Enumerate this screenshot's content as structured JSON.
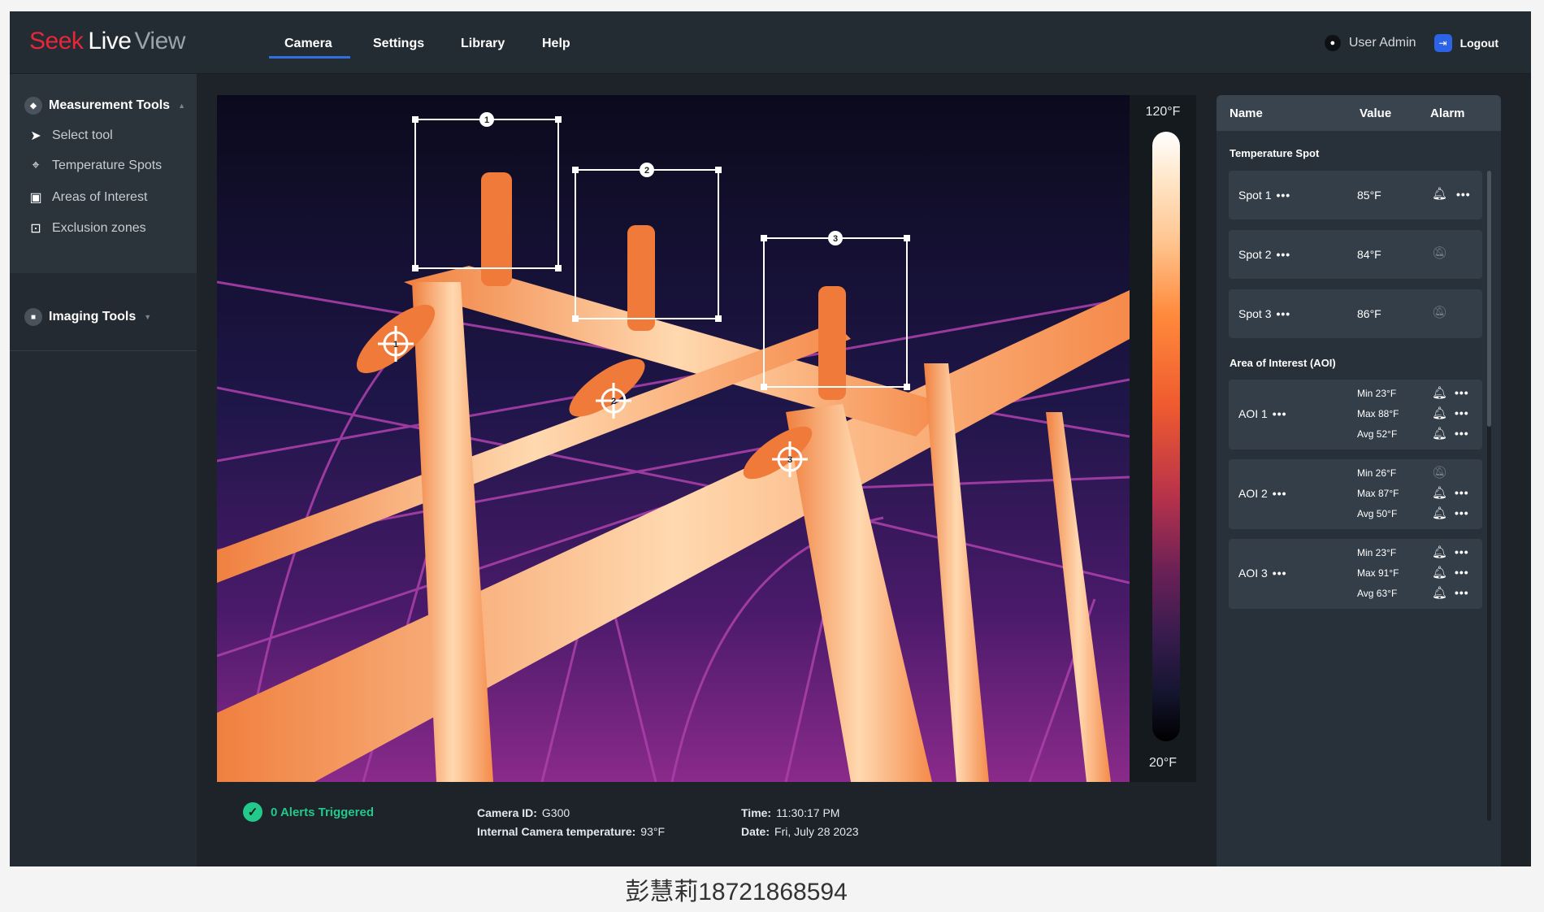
{
  "brand": {
    "part1": "Seek",
    "part2": "Live",
    "part3": "View"
  },
  "nav": {
    "tabs": [
      "Camera",
      "Settings",
      "Library",
      "Help"
    ],
    "active": "Camera"
  },
  "user": {
    "label": "User Admin",
    "logout": "Logout"
  },
  "sidebar": {
    "measurement_title": "Measurement Tools",
    "tools": [
      "Select tool",
      "Temperature Spots",
      "Areas of Interest",
      "Exclusion zones"
    ],
    "imaging_title": "Imaging Tools"
  },
  "camera": {
    "roi_labels": [
      "1",
      "2",
      "3"
    ],
    "spot_labels": [
      "1",
      "2",
      "3"
    ]
  },
  "scale": {
    "max": "120°F",
    "min": "20°F"
  },
  "status": {
    "alerts": "0 Alerts Triggered",
    "camera_id_label": "Camera ID:",
    "camera_id": "G300",
    "internal_temp_label": "Internal Camera temperature:",
    "internal_temp": "93°F",
    "time_label": "Time:",
    "time": "11:30:17 PM",
    "date_label": "Date:",
    "date": "Fri, July 28 2023"
  },
  "panel": {
    "headers": {
      "name": "Name",
      "value": "Value",
      "alarm": "Alarm"
    },
    "spot_group": "Temperature Spot",
    "spots": [
      {
        "name": "Spot 1",
        "value": "85°F",
        "alarm": "on"
      },
      {
        "name": "Spot 2",
        "value": "84°F",
        "alarm": "off"
      },
      {
        "name": "Spot 3",
        "value": "86°F",
        "alarm": "off"
      }
    ],
    "aoi_group": "Area of Interest (AOI)",
    "aois": [
      {
        "name": "AOI 1",
        "rows": [
          {
            "label": "Min 23°F",
            "alarm": "on"
          },
          {
            "label": "Max 88°F",
            "alarm": "on"
          },
          {
            "label": "Avg 52°F",
            "alarm": "on"
          }
        ]
      },
      {
        "name": "AOI 2",
        "rows": [
          {
            "label": "Min 26°F",
            "alarm": "off"
          },
          {
            "label": "Max 87°F",
            "alarm": "on"
          },
          {
            "label": "Avg 50°F",
            "alarm": "on"
          }
        ]
      },
      {
        "name": "AOI 3",
        "rows": [
          {
            "label": "Min 23°F",
            "alarm": "on"
          },
          {
            "label": "Max 91°F",
            "alarm": "on"
          },
          {
            "label": "Avg 63°F",
            "alarm": "on"
          }
        ]
      }
    ],
    "more_glyph": "•••"
  },
  "caption": "彭慧莉18721868594",
  "colors": {
    "accent": "#2f6fe0",
    "brand_red": "#e8263a",
    "alert_green": "#22c98a"
  }
}
